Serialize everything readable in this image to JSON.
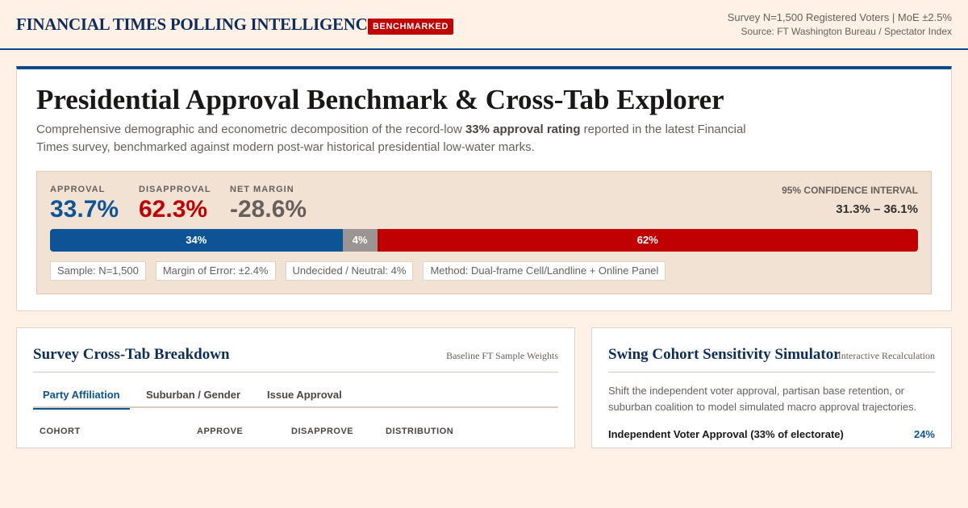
{
  "header": {
    "brand": "FINANCIAL TIMES POLLING INTELLIGENCE",
    "badge": "BENCHMARKED",
    "survey_meta": "Survey N=1,500 Registered Voters | MoE ±2.5%",
    "source": "Source: FT Washington Bureau / Spectator Index"
  },
  "hero": {
    "title": "Presidential Approval Benchmark & Cross-Tab Explorer",
    "lede_before": "Comprehensive demographic and econometric decomposition of the record-low ",
    "lede_bold": "33% approval rating",
    "lede_after": " reported in the latest Financial Times survey, benchmarked against modern post-war historical presidential low-water marks."
  },
  "metrics": {
    "approval": {
      "label": "APPROVAL",
      "value": "33.7%"
    },
    "disapproval": {
      "label": "DISAPPROVAL",
      "value": "62.3%"
    },
    "net": {
      "label": "NET MARGIN",
      "value": "-28.6%"
    },
    "ci": {
      "label": "95% CONFIDENCE INTERVAL",
      "value": "31.3% – 36.1%"
    }
  },
  "bar": {
    "segments": [
      {
        "label": "34%",
        "percent": 33.7,
        "color": "#0d5496"
      },
      {
        "label": "4%",
        "percent": 4.0,
        "color": "#9a9592"
      },
      {
        "label": "62%",
        "percent": 62.3,
        "color": "#c00000"
      }
    ]
  },
  "chips": [
    "Sample: N=1,500",
    "Margin of Error: ±2.4%",
    "Undecided / Neutral: 4%",
    "Method: Dual-frame Cell/Landline + Online Panel"
  ],
  "crosstab": {
    "title": "Survey Cross-Tab Breakdown",
    "note": "Baseline FT Sample Weights",
    "tabs": [
      "Party Affiliation",
      "Suburban / Gender",
      "Issue Approval"
    ],
    "active_tab": 0,
    "columns": [
      "COHORT",
      "APPROVE",
      "DISAPPROVE",
      "DISTRIBUTION"
    ]
  },
  "simulator": {
    "title": "Swing Cohort Sensitivity Simulator",
    "note": "Interactive Recalculation",
    "description": "Shift the independent voter approval, partisan base retention, or suburban coalition to model simulated macro approval trajectories.",
    "slider_label": "Independent Voter Approval (33% of electorate)",
    "slider_value": "24%"
  },
  "colors": {
    "brand_navy": "#0d2d5a",
    "approve_blue": "#0d5496",
    "disapprove_red": "#c00000",
    "neutral_gray": "#9a9592",
    "background": "#fff1e5"
  }
}
